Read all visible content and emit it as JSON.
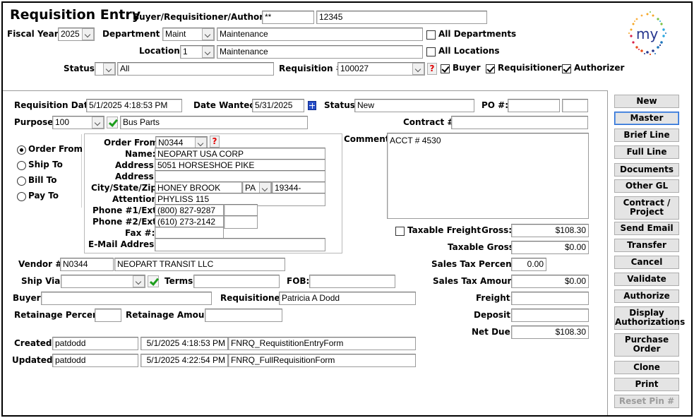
{
  "header": {
    "title": "Requisition Entry",
    "buyer_label": "Buyer/Requisitioner/Authorizer:",
    "buyer_code": "**",
    "buyer_id": "12345",
    "fiscal_year_label": "Fiscal Year:",
    "fiscal_year": "2025",
    "department_label": "Department #:",
    "department_code": "Maint",
    "department_name": "Maintenance",
    "all_departments_label": "All Departments",
    "location_label": "Location:",
    "location_code": "1",
    "location_name": "Maintenance",
    "all_locations_label": "All Locations",
    "status_label": "Status:",
    "status_code": "",
    "status_value": "All",
    "requisition_label": "Requisition #:",
    "requisition_value": "100027",
    "buyer_chk_label": "Buyer",
    "requisitioner_chk_label": "Requisitioner",
    "authorizer_chk_label": "Authorizer",
    "help_glyph": "?"
  },
  "logo": {
    "text": "my"
  },
  "form": {
    "req_date_label": "Requisition Date:",
    "req_date": "5/1/2025 4:18:53 PM",
    "date_wanted_label": "Date Wanted:",
    "date_wanted": "5/31/2025",
    "status_label": "Status:",
    "status": "New",
    "po_label": "PO #:",
    "po_value": "",
    "po_value2": "",
    "purpose_label": "Purpose:",
    "purpose_code": "100",
    "purpose_desc": "Bus Parts",
    "contract_label": "Contract #:",
    "contract_value": "",
    "address_types": [
      "Order From",
      "Ship To",
      "Bill To",
      "Pay To"
    ],
    "order_from_label": "Order From:",
    "order_from_code": "N0344",
    "name_label": "Name:",
    "name": "NEOPART USA CORP",
    "address_label": "Address:",
    "address1": "5051 HORSESHOE PIKE",
    "address2": "",
    "city_label": "City/State/Zip:",
    "city": "HONEY BROOK",
    "state": "PA",
    "zip": "19344-",
    "attention_label": "Attention:",
    "attention": "PHYLISS 115",
    "phone1_label": "Phone #1/Ext:",
    "phone1": "(800) 827-9287",
    "phone1_ext": "",
    "phone2_label": "Phone #2/Ext:",
    "phone2": "(610) 273-2142",
    "phone2_ext": "",
    "fax_label": "Fax #:",
    "fax": "",
    "email_label": "E-Mail Address:",
    "email": "",
    "comment_label": "Comment:",
    "comment": "ACCT # 4530",
    "taxable_freight_label": "Taxable Freight",
    "gross_label": "Gross:",
    "gross": "$108.30",
    "taxable_gross_label": "Taxable Gross:",
    "taxable_gross": "$0.00",
    "sales_tax_pct_label": "Sales Tax Percent:",
    "sales_tax_pct": "0.00",
    "sales_tax_amt_label": "Sales Tax Amount:",
    "sales_tax_amt": "$0.00",
    "freight_label": "Freight:",
    "freight": "",
    "deposit_label": "Deposit:",
    "deposit": "",
    "net_due_label": "Net Due:",
    "net_due": "$108.30",
    "vendor_label": "Vendor #:",
    "vendor_code": "N0344",
    "vendor_name": "NEOPART TRANSIT LLC",
    "ship_via_label": "Ship Via:",
    "ship_via": "",
    "terms_label": "Terms:",
    "terms": "",
    "fob_label": "FOB:",
    "fob": "",
    "buyer_label": "Buyer:",
    "buyer": "",
    "requisitioner_label": "Requisitioner:",
    "requisitioner": "Patricia A  Dodd",
    "retainage_pct_label": "Retainage Percent:",
    "retainage_pct": "",
    "retainage_amt_label": "Retainage Amount:",
    "retainage_amt": "",
    "created_label": "Created:",
    "created_user": "patdodd",
    "created_time": "5/1/2025 4:18:53 PM",
    "created_form": "FNRQ_RequistitionEntryForm",
    "updated_label": "Updated:",
    "updated_user": "patdodd",
    "updated_time": "5/1/2025 4:22:54 PM",
    "updated_form": "FNRQ_FullRequisitionForm"
  },
  "buttons": {
    "new": "New",
    "master": "Master",
    "brief_line": "Brief Line",
    "full_line": "Full Line",
    "documents": "Documents",
    "other_gl": "Other GL",
    "contract_project_1": "Contract /",
    "contract_project_2": "Project",
    "send_email": "Send Email",
    "transfer": "Transfer",
    "cancel": "Cancel",
    "validate": "Validate",
    "authorize": "Authorize",
    "display_auth_1": "Display",
    "display_auth_2": "Authorizations",
    "purchase_order_1": "Purchase",
    "purchase_order_2": "Order",
    "clone": "Clone",
    "print": "Print",
    "reset_pin": "Reset Pin #"
  },
  "colors": {
    "accent": "#2a6bd1",
    "help": "#e00000",
    "check_green": "#1e9e1e"
  }
}
